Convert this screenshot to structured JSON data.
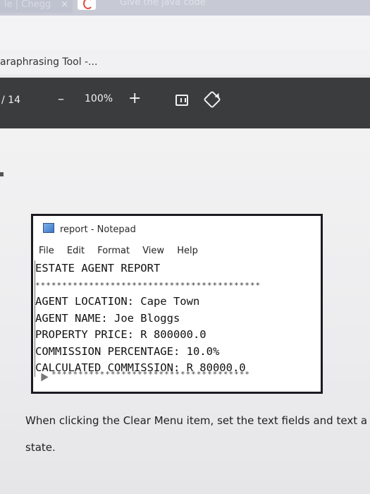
{
  "browser": {
    "tab1_label": "le | Chegg",
    "tab1_close": "×",
    "tab3_label": "Give the java code"
  },
  "bookmarks": {
    "item1": "araphrasing Tool -..."
  },
  "pdf_toolbar": {
    "page_count": "/ 14",
    "zoom_out": "–",
    "zoom_level": "100%",
    "zoom_in": "+"
  },
  "notepad": {
    "title": "report - Notepad",
    "menu": [
      "File",
      "Edit",
      "Format",
      "View",
      "Help"
    ],
    "lines": [
      "ESTATE AGENT REPORT",
      "******************************************",
      "AGENT LOCATION: Cape Town",
      "AGENT NAME: Joe Bloggs",
      "PROPERTY PRICE: R 800000.0",
      "COMMISSION PERCENTAGE: 10.0%",
      "CALCULATED COMMISSION: R 80000.0"
    ],
    "bottom_stars": "*************************************"
  },
  "document": {
    "line1": "When clicking the Clear Menu item, set the text fields and text a",
    "line2": "state."
  }
}
